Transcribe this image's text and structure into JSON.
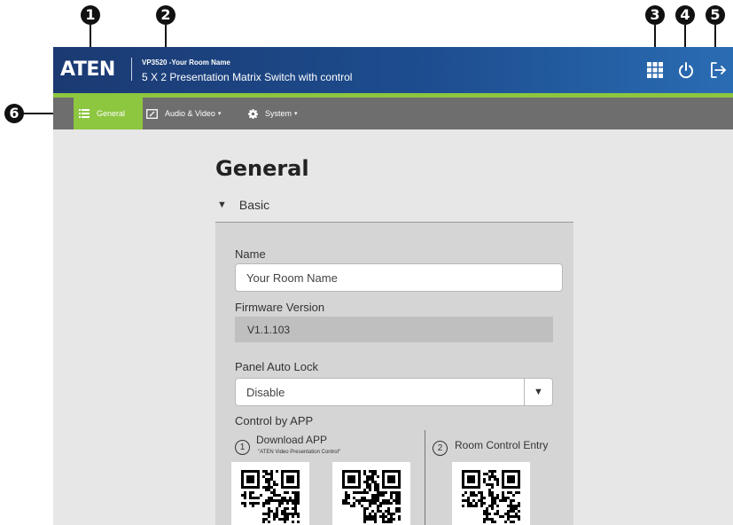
{
  "callouts": [
    "1",
    "2",
    "3",
    "4",
    "5",
    "6"
  ],
  "header": {
    "logo_text": "ATEN",
    "model_line": "VP3520 -Your Room Name",
    "device_description": "5 X 2 Presentation Matrix Switch with control",
    "icons": [
      "apps-grid-icon",
      "power-icon",
      "logout-icon"
    ]
  },
  "nav": {
    "items": [
      {
        "label": "General",
        "icon": "list-icon",
        "active": true
      },
      {
        "label": "Audio & Video",
        "icon": "av-icon",
        "caret": "▾"
      },
      {
        "label": "System",
        "icon": "gear-icon",
        "caret": "▾"
      }
    ]
  },
  "colors": {
    "header_blue": "#1d4d8f",
    "accent_green": "#8dc63f",
    "nav_gray": "#6e6e6e",
    "content_bg": "#e7e7e7",
    "panel_bg": "#d5d5d5"
  },
  "main": {
    "title": "General",
    "section": {
      "toggle": "▼",
      "label": "Basic"
    },
    "name": {
      "label": "Name",
      "value": "Your Room Name"
    },
    "firmware": {
      "label": "Firmware Version",
      "value": "V1.1.103"
    },
    "panel_auto_lock": {
      "label": "Panel Auto Lock",
      "value": "Disable",
      "arrow": "▼"
    },
    "control_app": {
      "label": "Control by APP",
      "download": {
        "number": "1",
        "title": "Download APP",
        "subtitle": "\"ATEN Video Presentation Control\""
      },
      "room_control": {
        "number": "2",
        "title": "Room Control Entry"
      }
    }
  }
}
